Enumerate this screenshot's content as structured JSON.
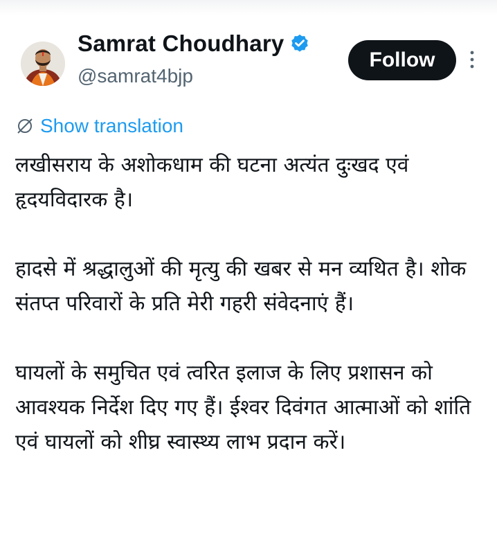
{
  "author": {
    "display_name": "Samrat Choudhary",
    "handle": "@samrat4bjp",
    "verified": true,
    "verified_icon": "verified-badge-icon",
    "avatar_icon": "profile-photo"
  },
  "actions": {
    "follow_label": "Follow",
    "more_icon": "more-options-icon"
  },
  "translation": {
    "icon": "globe-translate-icon",
    "label": "Show translation"
  },
  "post": {
    "paragraphs": [
      "लखीसराय के अशोकधाम की घटना अत्यंत दुःखद एवं हृदयविदारक है।",
      "हादसे में श्रद्धालुओं की मृत्यु की खबर से मन व्यथित है। शोक संतप्त परिवारों के प्रति मेरी गहरी संवेदनाएं हैं।",
      "घायलों के समुचित एवं त्वरित इलाज के लिए प्रशासन को आवश्यक निर्देश दिए गए हैं। ईश्वर दिवंगत आत्माओं को शांति एवं घायलों को शीघ्र स्वास्थ्य लाभ प्रदान करें।"
    ]
  },
  "colors": {
    "text_primary": "#0f1419",
    "text_secondary": "#536471",
    "link": "#1d9bf0",
    "follow_bg": "#0f1419",
    "verified": "#1d9bf0"
  }
}
